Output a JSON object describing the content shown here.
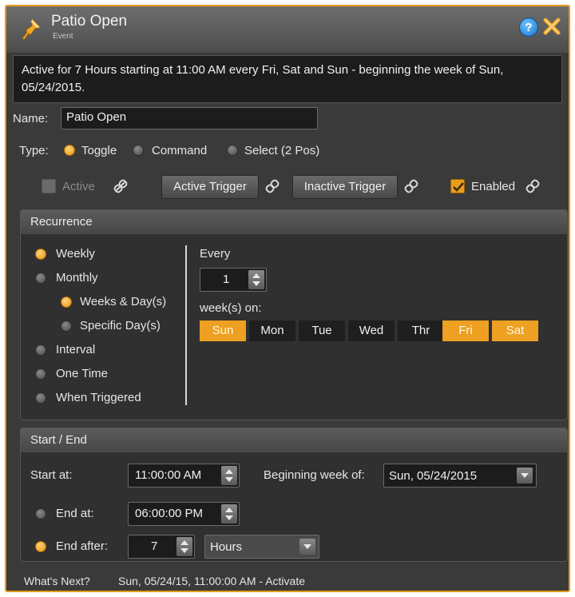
{
  "window": {
    "title": "Patio Open",
    "subtitle": "Event",
    "icon": "pushpin-icon",
    "help_glyph": "?"
  },
  "summary": "Active for 7 Hours starting at 11:00 AM every Fri, Sat and Sun - beginning the week of Sun, 05/24/2015.",
  "name": {
    "label": "Name:",
    "value": "Patio Open"
  },
  "type": {
    "label": "Type:",
    "options": [
      "Toggle",
      "Command",
      "Select (2 Pos)"
    ],
    "selected": "Toggle"
  },
  "controls": {
    "active_label": "Active",
    "active_checked": false,
    "active_trigger_label": "Active Trigger",
    "inactive_trigger_label": "Inactive Trigger",
    "enabled_label": "Enabled",
    "enabled_checked": true
  },
  "recurrence": {
    "header": "Recurrence",
    "options": {
      "weekly": "Weekly",
      "monthly": "Monthly",
      "weeks_days": "Weeks & Day(s)",
      "specific_days": "Specific Day(s)",
      "interval": "Interval",
      "one_time": "One Time",
      "when_triggered": "When Triggered"
    },
    "selected": "Weekly",
    "every_label": "Every",
    "every_value": "1",
    "weeks_on_label": "week(s) on:",
    "days": [
      {
        "label": "Sun",
        "on": true
      },
      {
        "label": "Mon",
        "on": false
      },
      {
        "label": "Tue",
        "on": false
      },
      {
        "label": "Wed",
        "on": false
      },
      {
        "label": "Thr",
        "on": false
      },
      {
        "label": "Fri",
        "on": true
      },
      {
        "label": "Sat",
        "on": true
      }
    ]
  },
  "start_end": {
    "header": "Start / End",
    "start_label": "Start at:",
    "start_value": "11:00:00 AM",
    "beginning_label": "Beginning week of:",
    "beginning_value": "Sun, 05/24/2015",
    "end_at_label": "End at:",
    "end_at_value": "06:00:00 PM",
    "end_after_label": "End after:",
    "end_after_value": "7",
    "end_after_unit": "Hours",
    "selected": "End after"
  },
  "footer": {
    "label": "What's Next?",
    "value": "Sun, 05/24/15, 11:00:00 AM - Activate"
  },
  "colors": {
    "accent": "#e39a1b",
    "day_selected": "#eda021",
    "background": "#3a3a3a",
    "field": "#1c1c1c"
  }
}
